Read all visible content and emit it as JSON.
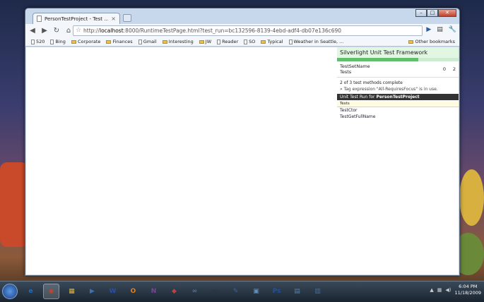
{
  "browser": {
    "tab_title": "PersonTestProject - Test ...",
    "tab_close": "×",
    "address_host": "localhost",
    "address_rest": ":8000/RuntimeTestPage.html?test_run=bc132596-8139-4ebd-adf4-db07e136c690",
    "address_prefix": "http://",
    "nav": {
      "back": "◀",
      "forward": "▶",
      "reload": "↻",
      "home": "⌂"
    },
    "window_controls": {
      "minimize": "–",
      "maximize": "□",
      "close": "✕"
    },
    "go": "▶",
    "page_menu": "▤",
    "tools_menu": "🔧"
  },
  "bookmarks": {
    "items": [
      {
        "label": "520",
        "icon": "page"
      },
      {
        "label": "Bing",
        "icon": "page"
      },
      {
        "label": "Corporate",
        "icon": "folder"
      },
      {
        "label": "Finances",
        "icon": "folder"
      },
      {
        "label": "Gmail",
        "icon": "page"
      },
      {
        "label": "Interesting",
        "icon": "folder"
      },
      {
        "label": "JW",
        "icon": "folder"
      },
      {
        "label": "Reader",
        "icon": "page"
      },
      {
        "label": "SO",
        "icon": "page"
      },
      {
        "label": "Typical",
        "icon": "folder"
      },
      {
        "label": "Weather in Seattle, ...",
        "icon": "page"
      }
    ],
    "other": "Other bookmarks"
  },
  "test_framework": {
    "title": "Silverlight Unit Test Framework",
    "progress_fraction": 0.67,
    "summary_col": "TestSetName",
    "summary_row": "Tests",
    "count_a": "0",
    "count_b": "2",
    "status": "2 of 3 test methods complete",
    "tag_expression": "» Tag expression \"All-RequiresFocus\" is in use.",
    "run_label": "Unit Test Run for",
    "run_project": "PersonTestProject",
    "tests_tab": "Tests",
    "tests": [
      "TestCtor",
      "TestGetFullName"
    ]
  },
  "taskbar": {
    "apps": [
      "e",
      "◉",
      "▦",
      "▶",
      "W",
      "O",
      "N",
      "◆",
      "∞",
      "▭",
      "✎",
      "▣",
      "Ps",
      "▤",
      "▥"
    ],
    "time": "6:04 PM",
    "date": "11/18/2009"
  }
}
